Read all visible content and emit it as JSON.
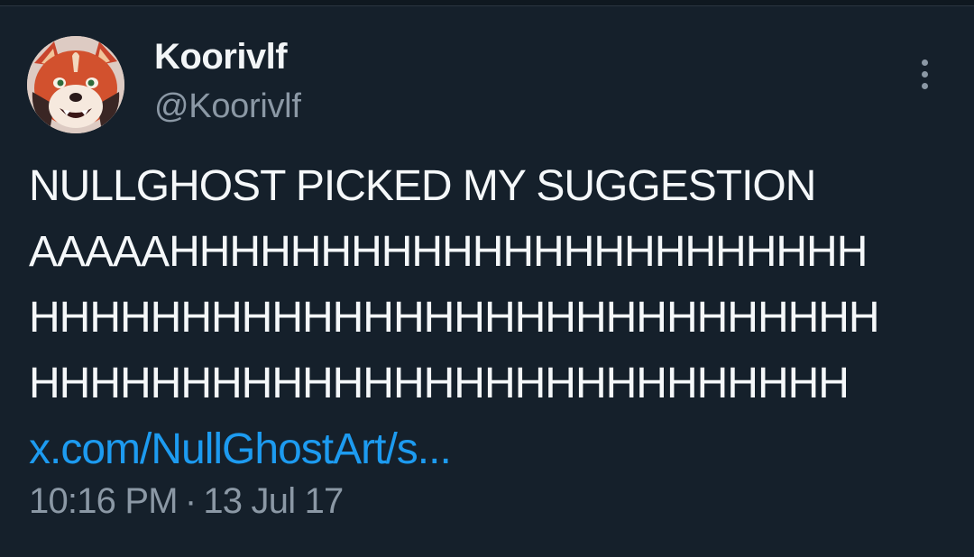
{
  "author": {
    "display_name": "Koorivlf",
    "handle": "@Koorivlf",
    "avatar_icon": "fox-character-avatar"
  },
  "tweet": {
    "lines": [
      "NULLGHOST PICKED MY SUGGESTION",
      "AAAAAHHHHHHHHHHHHHHHHHHHHHHH",
      "HHHHHHHHHHHHHHHHHHHHHHHHHHHH",
      "HHHHHHHHHHHHHHHHHHHHHHHHHHH"
    ],
    "link": "x.com/NullGhostArt/s..."
  },
  "meta": {
    "time": "10:16 PM",
    "separator": "·",
    "date": "13 Jul 17"
  },
  "icons": {
    "more": "more-vertical-icon"
  },
  "colors": {
    "background": "#15202b",
    "text": "#f5f8fa",
    "secondary": "#8b98a5",
    "link": "#1d9bf0"
  }
}
